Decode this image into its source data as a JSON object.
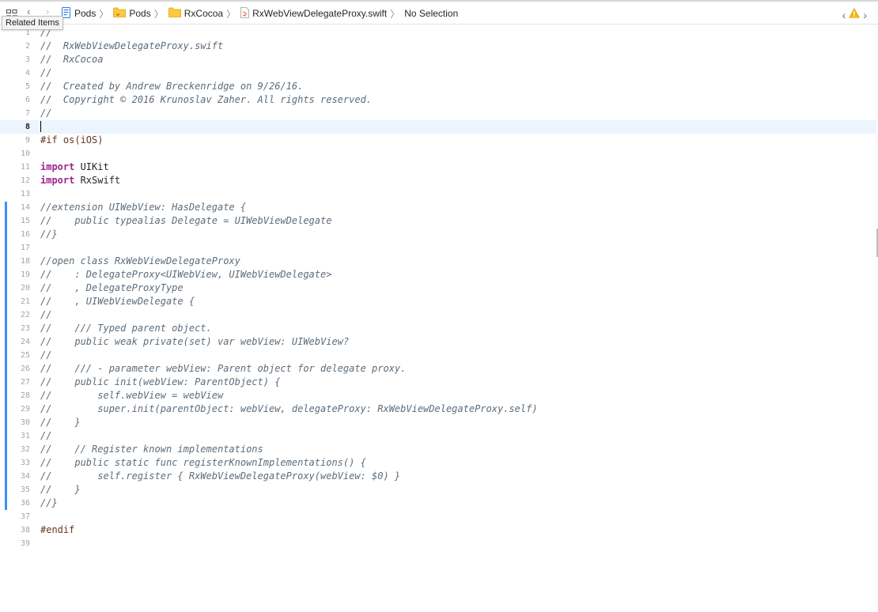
{
  "jump_bar": {
    "tooltip": "Related Items",
    "breadcrumbs": [
      {
        "label": "Pods",
        "icon": "project-icon"
      },
      {
        "label": "Pods",
        "icon": "folder-icon"
      },
      {
        "label": "RxCocoa",
        "icon": "folder-icon"
      },
      {
        "label": "RxWebViewDelegateProxy.swift",
        "icon": "swift-file-icon"
      },
      {
        "label": "No Selection",
        "icon": ""
      }
    ],
    "warning_count_icon": "warning-icon"
  },
  "colors": {
    "comment": "#5d6c79",
    "keyword": "#9b2393",
    "directive": "#643820",
    "change_bar": "#3e8ef7",
    "current_line": "#ecf4fe",
    "warning": "#f5b80b"
  },
  "editor": {
    "current_line": 8,
    "lines": [
      {
        "n": "1",
        "segments": [
          {
            "t": "//",
            "k": "comment"
          }
        ]
      },
      {
        "n": "2",
        "segments": [
          {
            "t": "//  RxWebViewDelegateProxy.swift",
            "k": "comment"
          }
        ]
      },
      {
        "n": "3",
        "segments": [
          {
            "t": "//  RxCocoa",
            "k": "comment"
          }
        ]
      },
      {
        "n": "4",
        "segments": [
          {
            "t": "//",
            "k": "comment"
          }
        ]
      },
      {
        "n": "5",
        "segments": [
          {
            "t": "//  Created by Andrew Breckenridge on 9/26/16.",
            "k": "comment"
          }
        ]
      },
      {
        "n": "6",
        "segments": [
          {
            "t": "//  Copyright © 2016 Krunoslav Zaher. All rights reserved.",
            "k": "comment"
          }
        ]
      },
      {
        "n": "7",
        "segments": [
          {
            "t": "//",
            "k": "comment"
          }
        ]
      },
      {
        "n": "8",
        "segments": []
      },
      {
        "n": "9",
        "segments": [
          {
            "t": "#if os(iOS)",
            "k": "directive"
          }
        ]
      },
      {
        "n": "10",
        "segments": []
      },
      {
        "n": "11",
        "segments": [
          {
            "t": "import",
            "k": "keyword"
          },
          {
            "t": " UIKit",
            "k": "plain"
          }
        ]
      },
      {
        "n": "12",
        "segments": [
          {
            "t": "import",
            "k": "keyword"
          },
          {
            "t": " RxSwift",
            "k": "plain"
          }
        ]
      },
      {
        "n": "13",
        "segments": []
      },
      {
        "n": "14",
        "segments": [
          {
            "t": "//extension UIWebView: HasDelegate {",
            "k": "comment"
          }
        ]
      },
      {
        "n": "15",
        "segments": [
          {
            "t": "//    public typealias Delegate = UIWebViewDelegate",
            "k": "comment"
          }
        ]
      },
      {
        "n": "16",
        "segments": [
          {
            "t": "//}",
            "k": "comment"
          }
        ]
      },
      {
        "n": "17",
        "segments": []
      },
      {
        "n": "18",
        "segments": [
          {
            "t": "//open class RxWebViewDelegateProxy",
            "k": "comment"
          }
        ]
      },
      {
        "n": "19",
        "segments": [
          {
            "t": "//    : DelegateProxy<UIWebView, UIWebViewDelegate>",
            "k": "comment"
          }
        ]
      },
      {
        "n": "20",
        "segments": [
          {
            "t": "//    , DelegateProxyType",
            "k": "comment"
          }
        ]
      },
      {
        "n": "21",
        "segments": [
          {
            "t": "//    , UIWebViewDelegate {",
            "k": "comment"
          }
        ]
      },
      {
        "n": "22",
        "segments": [
          {
            "t": "//",
            "k": "comment"
          }
        ]
      },
      {
        "n": "23",
        "segments": [
          {
            "t": "//    /// Typed parent object.",
            "k": "comment"
          }
        ]
      },
      {
        "n": "24",
        "segments": [
          {
            "t": "//    public weak private(set) var webView: UIWebView?",
            "k": "comment"
          }
        ]
      },
      {
        "n": "25",
        "segments": [
          {
            "t": "//",
            "k": "comment"
          }
        ]
      },
      {
        "n": "26",
        "segments": [
          {
            "t": "//    /// - parameter webView: Parent object for delegate proxy.",
            "k": "comment"
          }
        ]
      },
      {
        "n": "27",
        "segments": [
          {
            "t": "//    public init(webView: ParentObject) {",
            "k": "comment"
          }
        ]
      },
      {
        "n": "28",
        "segments": [
          {
            "t": "//        self.webView = webView",
            "k": "comment"
          }
        ]
      },
      {
        "n": "29",
        "segments": [
          {
            "t": "//        super.init(parentObject: webView, delegateProxy: RxWebViewDelegateProxy.self)",
            "k": "comment"
          }
        ]
      },
      {
        "n": "30",
        "segments": [
          {
            "t": "//    }",
            "k": "comment"
          }
        ]
      },
      {
        "n": "31",
        "segments": [
          {
            "t": "//",
            "k": "comment"
          }
        ]
      },
      {
        "n": "32",
        "segments": [
          {
            "t": "//    // Register known implementations",
            "k": "comment"
          }
        ]
      },
      {
        "n": "33",
        "segments": [
          {
            "t": "//    public static func registerKnownImplementations() {",
            "k": "comment"
          }
        ]
      },
      {
        "n": "34",
        "segments": [
          {
            "t": "//        self.register { RxWebViewDelegateProxy(webView: $0) }",
            "k": "comment"
          }
        ]
      },
      {
        "n": "35",
        "segments": [
          {
            "t": "//    }",
            "k": "comment"
          }
        ]
      },
      {
        "n": "36",
        "segments": [
          {
            "t": "//}",
            "k": "comment"
          }
        ]
      },
      {
        "n": "37",
        "segments": []
      },
      {
        "n": "38",
        "segments": [
          {
            "t": "#endif",
            "k": "directive"
          }
        ]
      },
      {
        "n": "39",
        "segments": []
      }
    ]
  }
}
